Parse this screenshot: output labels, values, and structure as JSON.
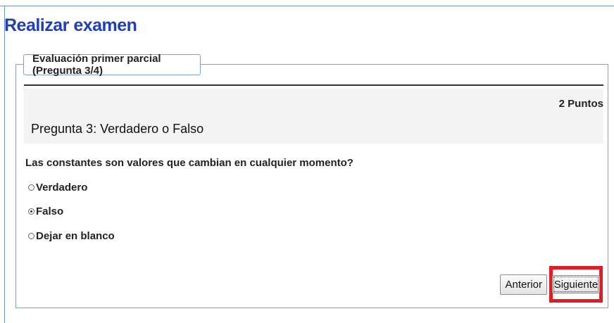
{
  "page": {
    "title": "Realizar examen"
  },
  "exam": {
    "legend": "Evaluación primer parcial (Pregunta 3/4)"
  },
  "question": {
    "points": "2 Puntos",
    "title": "Pregunta 3:  Verdadero o Falso",
    "text": "Las constantes son valores que cambian en cualquier momento?",
    "selected_option": "Falso",
    "options": [
      {
        "label": "Verdadero",
        "checked": false
      },
      {
        "label": "Falso",
        "checked": true
      },
      {
        "label": "Dejar en blanco",
        "checked": false
      }
    ]
  },
  "navigation": {
    "previous_label": "Anterior",
    "next_label": "Siguiente",
    "highlight_color": "#e31b23"
  },
  "colors": {
    "title": "#1f3fb4",
    "border": "#7fa0cc",
    "question_header_background": "#f3f3f3"
  }
}
